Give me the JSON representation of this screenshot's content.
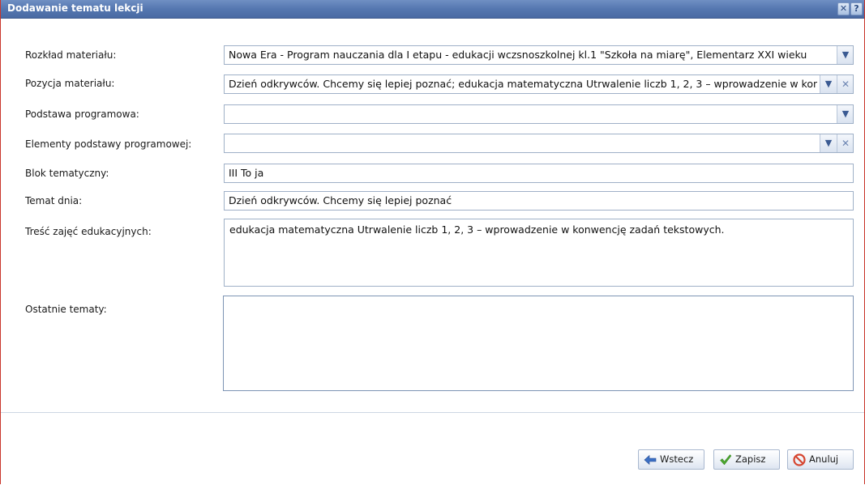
{
  "window": {
    "title": "Dodawanie tematu lekcji",
    "close_icon": "close-icon",
    "help_icon": "help-icon"
  },
  "form": {
    "rozklad": {
      "label": "Rozkład materiału:",
      "value": "Nowa Era - Program nauczania dla I etapu - edukacji wczsnoszkolnej kl.1 \"Szkoła na miarę\", Elementarz XXI wieku"
    },
    "pozycja": {
      "label": "Pozycja materiału:",
      "value": "Dzień odkrywców. Chcemy się lepiej poznać; edukacja matematyczna Utrwalenie liczb 1, 2, 3 – wprowadzenie w konwencję zadań tekstowych."
    },
    "podstawa": {
      "label": "Podstawa programowa:",
      "value": ""
    },
    "elementy": {
      "label": "Elementy podstawy programowej:",
      "value": ""
    },
    "blok": {
      "label": "Blok tematyczny:",
      "value": "III To ja"
    },
    "temat_dnia": {
      "label": "Temat dnia:",
      "value": "Dzień odkrywców. Chcemy się lepiej poznać"
    },
    "tresc": {
      "label": "Treść zajęć edukacyjnych:",
      "value": "edukacja matematyczna Utrwalenie liczb 1, 2, 3 – wprowadzenie w konwencję zadań tekstowych."
    },
    "ostatnie": {
      "label": "Ostatnie tematy:",
      "value": ""
    }
  },
  "buttons": {
    "wstecz": "Wstecz",
    "zapisz": "Zapisz",
    "anuluj": "Anuluj"
  },
  "colors": {
    "titlebar": "#5577b0",
    "window_border": "#c9362b",
    "field_border": "#9fb0c7",
    "arrow_icon": "#3b5b93",
    "check_icon": "#4aa52e",
    "cancel_icon": "#d6452f"
  }
}
